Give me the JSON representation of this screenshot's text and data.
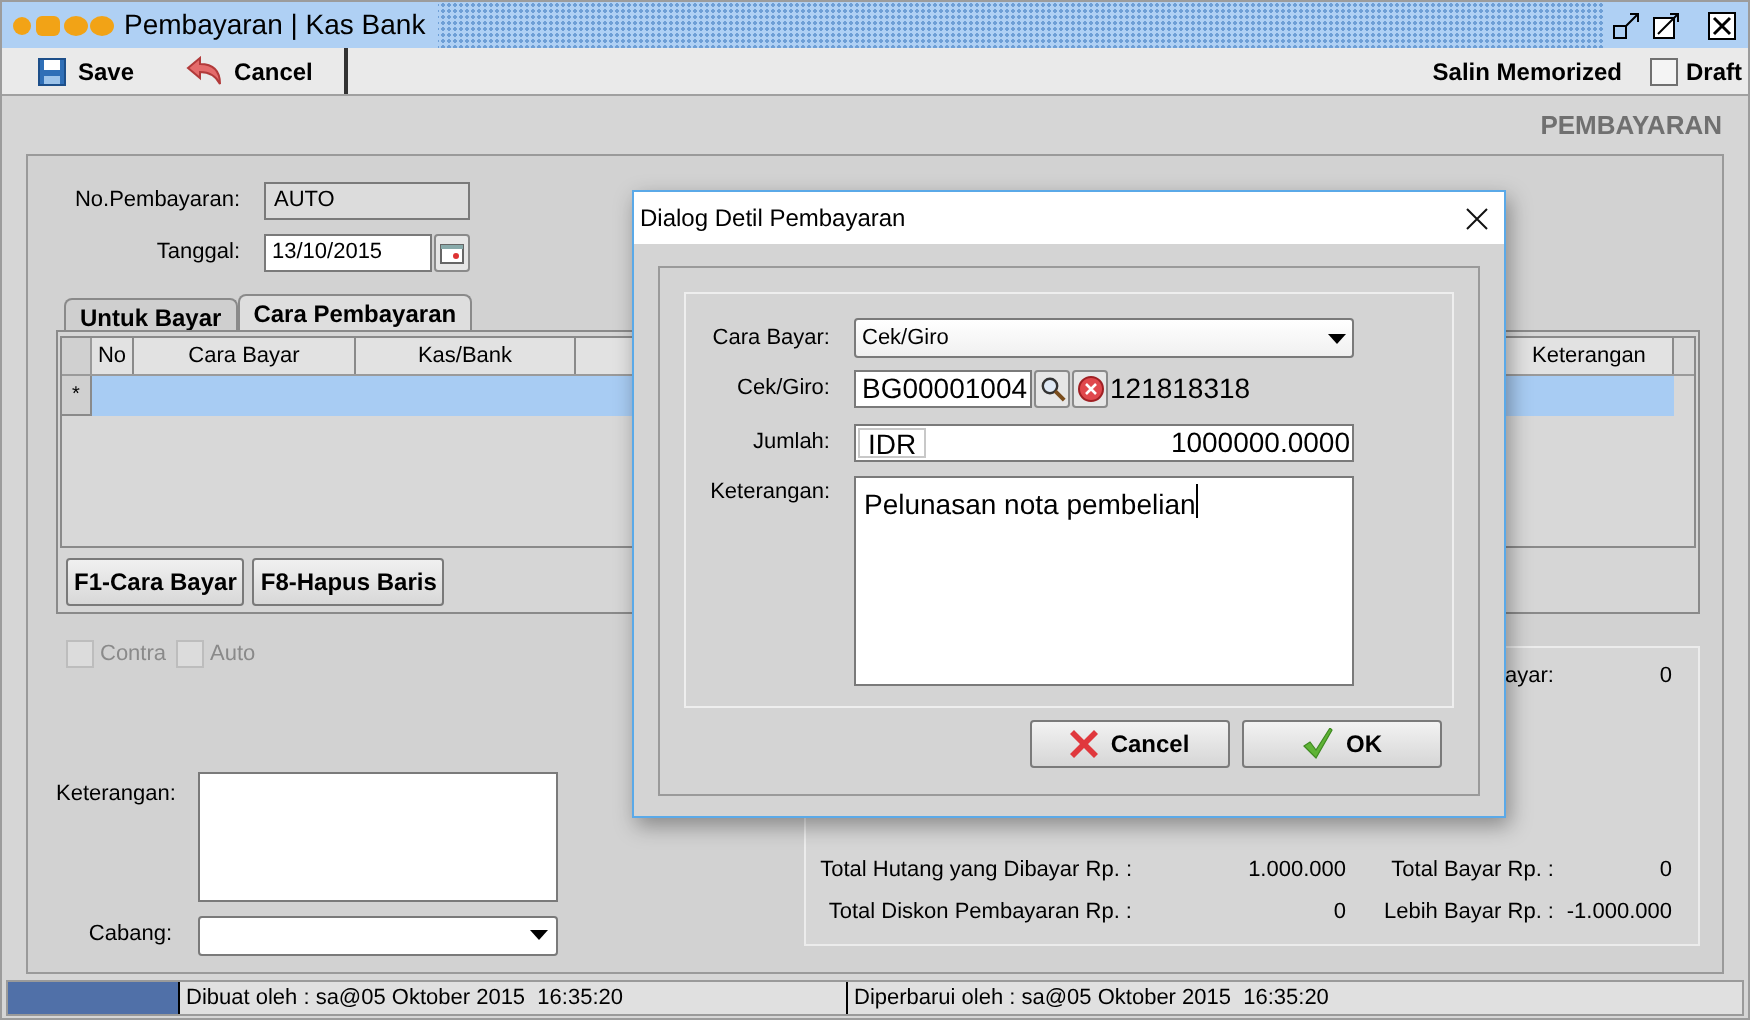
{
  "window": {
    "title": "Pembayaran | Kas Bank"
  },
  "toolbar": {
    "buttons": [
      {
        "label": "Save",
        "kind": "save"
      },
      {
        "label": "Cancel",
        "kind": "cancel"
      }
    ],
    "memorized": "Salin Memorized",
    "draft": {
      "label": "Draft",
      "checked": false
    }
  },
  "form_title": "PEMBAYARAN",
  "no_pembayaran": {
    "label": "No.Pembayaran:",
    "value": "AUTO"
  },
  "tanggal": {
    "label": "Tanggal:",
    "value": "13/10/2015"
  },
  "tabs": [
    {
      "label": "Untuk Bayar",
      "selected": false
    },
    {
      "label": "Cara Pembayaran",
      "selected": true
    }
  ],
  "grid": {
    "columns": [
      "No",
      "Cara Bayar",
      "Kas/Bank",
      "Keterangan"
    ],
    "rows": [
      {
        "marker": "*",
        "selected": true
      }
    ]
  },
  "grid_buttons": [
    "F1-Cara Bayar",
    "F8-Hapus Baris"
  ],
  "options": [
    {
      "label": "Contra",
      "checked": false,
      "disabled": true
    },
    {
      "label": "Auto",
      "checked": false,
      "disabled": true
    }
  ],
  "keterangan": {
    "label": "Keterangan:"
  },
  "cabang": {
    "label": "Cabang:"
  },
  "summary": {
    "top_label": "ayar:",
    "top_value": "0",
    "rows": [
      {
        "label": "Total Hutang yang Dibayar Rp. :",
        "value": "1.000.000",
        "label_2": "Total Bayar Rp. :",
        "value_2": "0"
      },
      {
        "label": "Total Diskon Pembayaran Rp. :",
        "value": "0",
        "label_2": "Lebih Bayar Rp. :",
        "value_2": "-1.000.000"
      }
    ]
  },
  "status_bar": {
    "level": 1,
    "created": "Dibuat oleh : sa@05 Oktober 2015  16:35:20",
    "updated": "Diperbarui oleh : sa@05 Oktober 2015  16:35:20"
  },
  "dialog": {
    "title": "Dialog Detil Pembayaran",
    "cara_bayar": {
      "label": "Cara Bayar:",
      "value": "Cek/Giro"
    },
    "cek_giro": {
      "label": "Cek/Giro:",
      "value": "BG00001004",
      "number": "121818318"
    },
    "jumlah": {
      "label": "Jumlah:",
      "currency": "IDR",
      "value": "1000000.0000"
    },
    "keterangan": {
      "label": "Keterangan:",
      "value": "Pelunasan nota pembelian"
    },
    "buttons": [
      {
        "label": "Cancel",
        "kind": "cancel"
      },
      {
        "label": "OK",
        "kind": "ok"
      }
    ]
  }
}
